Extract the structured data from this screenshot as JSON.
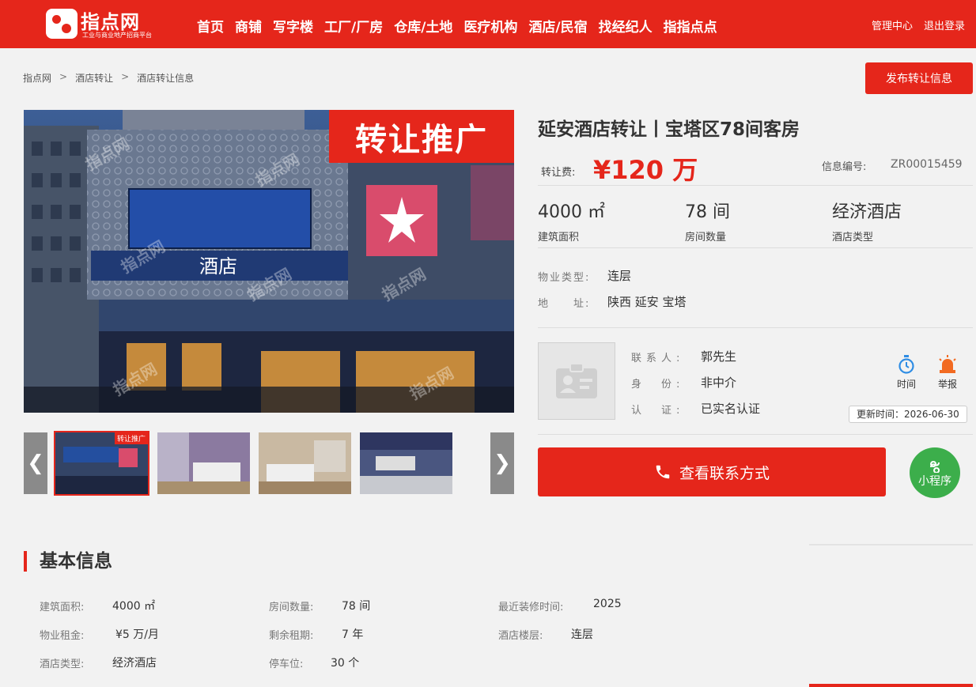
{
  "header": {
    "logo_name": "指点网",
    "logo_slogan": "工业与商业地产招商平台",
    "nav": [
      "首页",
      "商铺",
      "写字楼",
      "工厂/厂房",
      "仓库/土地",
      "医疗机构",
      "酒店/民宿",
      "找经纪人",
      "指指点点"
    ],
    "admin_center": "管理中心",
    "logout": "退出登录"
  },
  "breadcrumb": {
    "items": [
      "指点网",
      "酒店转让",
      "酒店转让信息"
    ],
    "separator": ">"
  },
  "publish_button": "发布转让信息",
  "gallery": {
    "promo_tag": "转让推广",
    "main_sign": "酒店",
    "watermark": "指点网",
    "thumb_tag": "转让推广",
    "prev_icon": "chevron-left-icon",
    "next_icon": "chevron-right-icon"
  },
  "listing": {
    "title": "延安酒店转让丨宝塔区78间客房",
    "price_label": "转让费:",
    "price_value": "¥120 万",
    "info_no_label": "信息编号:",
    "info_no_value": "ZR00015459",
    "stats": [
      {
        "value": "4000 ㎡",
        "label": "建筑面积"
      },
      {
        "value": "78 间",
        "label": "房间数量"
      },
      {
        "value": "经济酒店",
        "label": "酒店类型"
      }
    ],
    "property_type_label": "物业类型:",
    "property_type_value": "连层",
    "address_label": "地　　址:",
    "address_value": "陕西 延安 宝塔"
  },
  "contact": {
    "contact_label": "联系人:",
    "contact_value": "郭先生",
    "identity_label": "身　份:",
    "identity_value": "非中介",
    "auth_label": "认　证:",
    "auth_value": "已实名认证",
    "time_tool": "时间",
    "report_tool": "举报",
    "update_time": "更新时间：2026-06-30",
    "contact_button": "查看联系方式",
    "mini_program": "小程序"
  },
  "basic_info": {
    "title": "基本信息",
    "rows": [
      [
        {
          "label": "建筑面积:",
          "value": "4000 ㎡"
        },
        {
          "label": "房间数量:",
          "value": "78 间"
        },
        {
          "label": "最近装修时间:",
          "value": "2025"
        }
      ],
      [
        {
          "label": "物业租金:",
          "value": "¥5 万/月"
        },
        {
          "label": "剩余租期:",
          "value": "7 年"
        },
        {
          "label": "酒店楼层:",
          "value": "连层"
        }
      ],
      [
        {
          "label": "酒店类型:",
          "value": "经济酒店"
        },
        {
          "label": "停车位:",
          "value": "30 个"
        }
      ]
    ]
  },
  "colors": {
    "brand_red": "#e5261b",
    "mini_green": "#3cae4b"
  }
}
